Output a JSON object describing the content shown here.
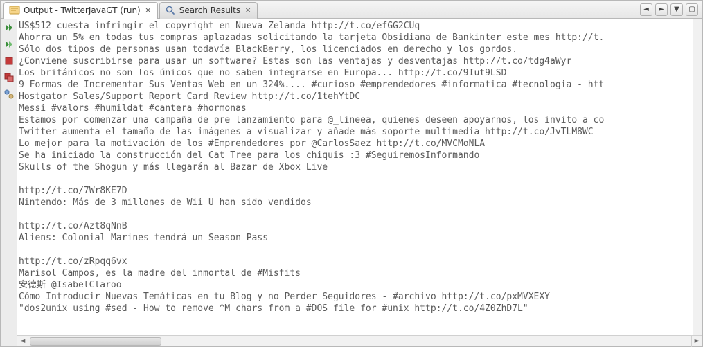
{
  "tabs": [
    {
      "label": "Output - TwitterJavaGT (run)",
      "icon": "output-icon",
      "active": true
    },
    {
      "label": "Search Results",
      "icon": "search-icon",
      "active": false
    }
  ],
  "toolbar_right": {
    "prev": "◄",
    "next": "►",
    "dropdown": "▼",
    "maximize": "▢"
  },
  "gutter_icons": [
    "rerun-icon",
    "run-icon",
    "stop-icon",
    "stop-all-icon",
    "settings-icon"
  ],
  "output_lines": [
    "US$512 cuesta infringir el copyright en Nueva Zelanda http://t.co/efGG2CUq",
    "Ahorra un 5% en todas tus compras aplazadas solicitando la tarjeta Obsidiana de Bankinter este mes http://t.",
    "Sólo dos tipos de personas usan todavía BlackBerry, los licenciados en derecho y los gordos.",
    "¿Conviene suscribirse para usar un software? Estas son las ventajas y desventajas http://t.co/tdg4aWyr",
    "Los británicos no son los únicos que no saben integrarse en Europa... http://t.co/9Iut9LSD",
    "9 Formas de Incrementar Sus Ventas Web en un 324%.... #curioso #emprendedores #informatica #tecnologia - htt",
    "Hostgator Sales/Support Report Card Review http://t.co/1tehYtDC",
    "Messi #valors #humildat #cantera #hormonas",
    "Estamos por comenzar una campaña de pre lanzamiento para @_lineea, quienes deseen apoyarnos, los invito a co",
    "Twitter aumenta el tamaño de las imágenes a visualizar y añade más soporte multimedia http://t.co/JvTLM8WC",
    "Lo mejor para la motivación de los #Emprendedores por @CarlosSaez http://t.co/MVCMoNLA",
    "Se ha iniciado la construcción del Cat Tree para los chiquis :3 #SeguiremosInformando",
    "Skulls of the Shogun y más llegarán al Bazar de Xbox Live",
    "",
    "http://t.co/7Wr8KE7D",
    "Nintendo: Más de 3 millones de Wii U han sido vendidos",
    "",
    "http://t.co/Azt8qNnB",
    "Aliens: Colonial Marines tendrá un Season Pass",
    "",
    "http://t.co/zRpqq6vx",
    "Marisol Campos, es la madre del inmortal de #Misfits",
    "安德斯 @IsabelClaroo",
    "Cómo Introducir Nuevas Temáticas en tu Blog y no Perder Seguidores - #archivo http://t.co/pxMVXEXY",
    "\"dos2unix using #sed - How to remove ^M chars from a #DOS file for #unix http://t.co/4Z0ZhD7L\""
  ]
}
